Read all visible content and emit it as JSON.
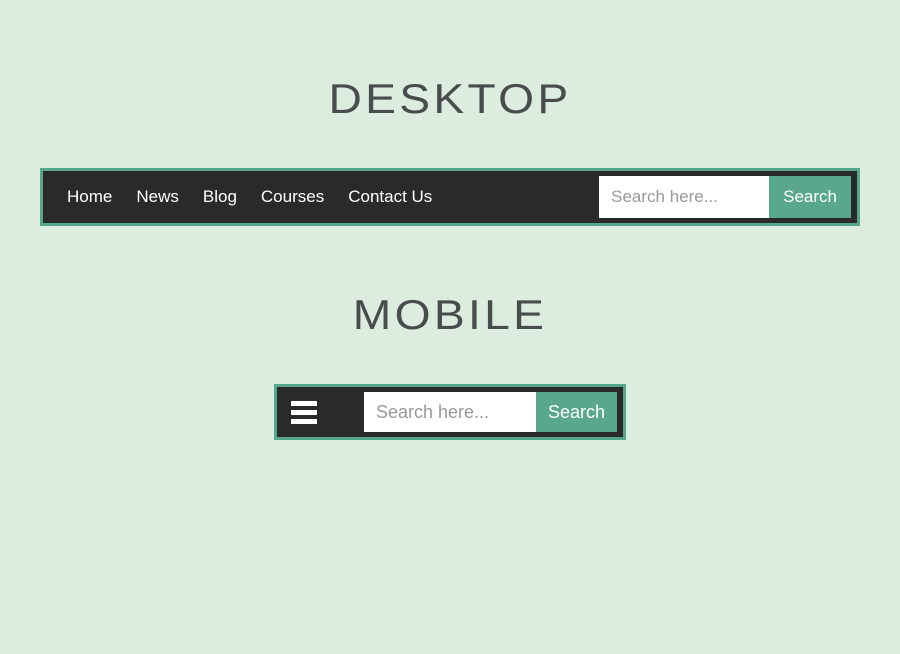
{
  "headings": {
    "desktop": "DESKTOP",
    "mobile": "MOBILE"
  },
  "nav": {
    "items": [
      "Home",
      "News",
      "Blog",
      "Courses",
      "Contact Us"
    ]
  },
  "search": {
    "placeholder": "Search here...",
    "button": "Search"
  }
}
